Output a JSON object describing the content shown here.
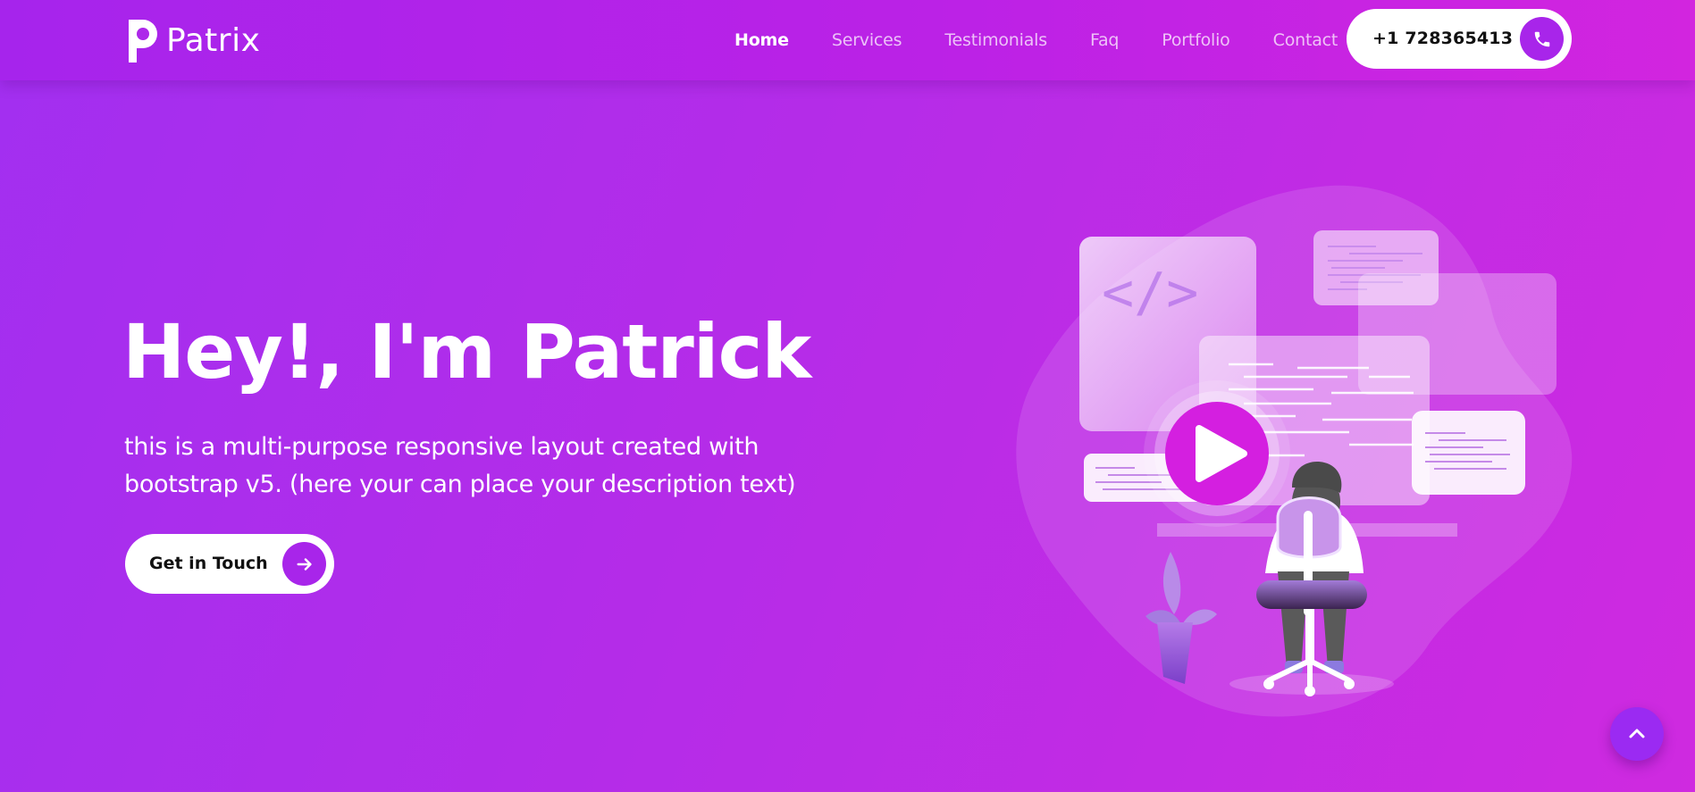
{
  "brand": {
    "name": "Patrix",
    "logo_icon": "p-logo-icon"
  },
  "nav": {
    "items": [
      {
        "label": "Home",
        "active": true
      },
      {
        "label": "Services",
        "active": false
      },
      {
        "label": "Testimonials",
        "active": false
      },
      {
        "label": "Faq",
        "active": false
      },
      {
        "label": "Portfolio",
        "active": false
      },
      {
        "label": "Contact",
        "active": false
      }
    ],
    "phone": {
      "number": "+1 728365413",
      "icon": "phone-icon"
    }
  },
  "hero": {
    "title": "Hey!, I'm Patrick",
    "description": "this is a multi-purpose responsive layout created with bootstrap v5. (here your can place your description text)",
    "cta_label": "Get in Touch",
    "cta_icon": "arrow-right-icon",
    "illustration_play_icon": "play-icon"
  },
  "scroll_top_icon": "chevron-up-icon",
  "colors": {
    "accent": "#a825ea",
    "background_start": "#a22ff0",
    "background_end": "#cf2ae0",
    "play_button": "#d41fe0"
  }
}
